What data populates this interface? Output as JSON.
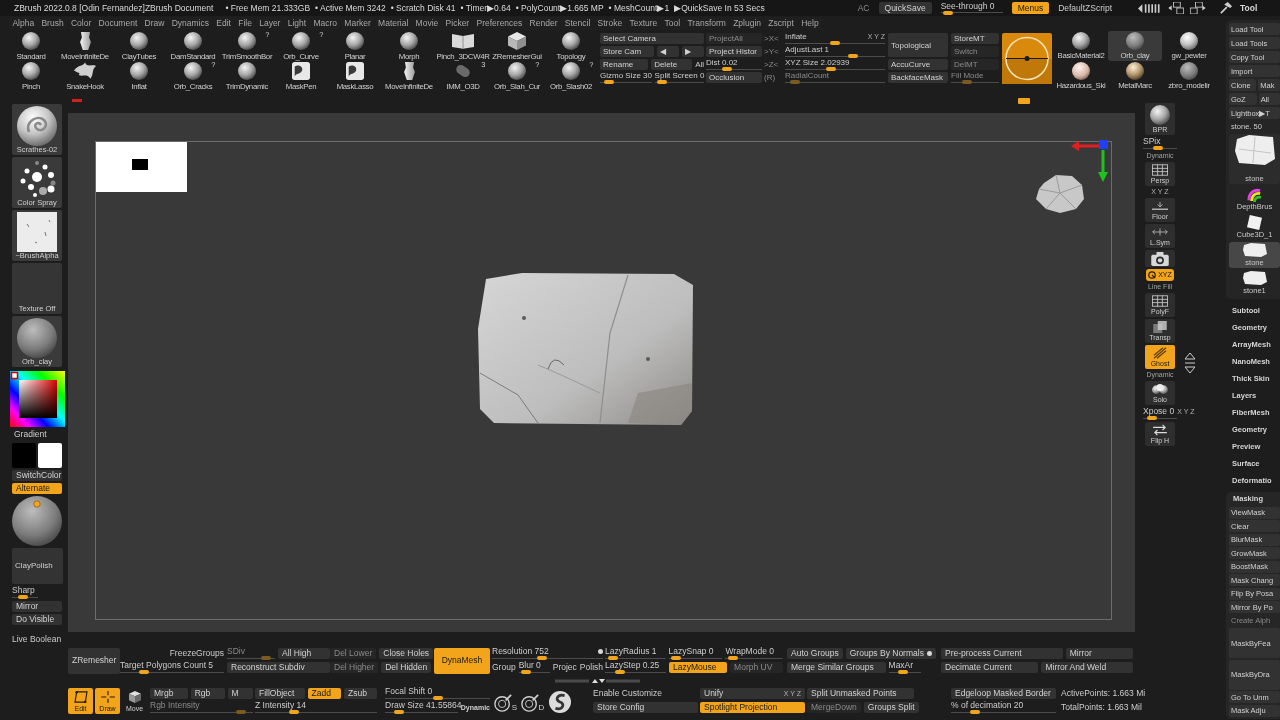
{
  "title_bar": {
    "title": "ZBrush 2022.0.8 [Odin Fernandez]ZBrush Document",
    "stats": [
      "• Free Mem 21.333GB",
      "• Active Mem 3242",
      "• Scratch Disk 41",
      "• Timer▶0.64",
      "• PolyCount▶1.665 MP",
      "• MeshCount▶1",
      "▶QuickSave In 53 Secs"
    ],
    "controls": [
      {
        "kind": "hint",
        "label": "AC"
      },
      {
        "kind": "button",
        "label": "QuickSave",
        "on": false,
        "disabled": false
      },
      {
        "kind": "slider",
        "label": "See-through 0",
        "level": 0.05,
        "disabled": false
      },
      {
        "kind": "button",
        "label": "Menus",
        "on": true,
        "disabled": false
      },
      {
        "kind": "text",
        "label": "DefaultZScript"
      }
    ],
    "palette_title": "Tool"
  },
  "menu_bar": [
    "Alpha",
    "Brush",
    "Color",
    "Document",
    "Draw",
    "Dynamics",
    "Edit",
    "File",
    "Layer",
    "Light",
    "Macro",
    "Marker",
    "Material",
    "Movie",
    "Picker",
    "Preferences",
    "Render",
    "Stencil",
    "Stroke",
    "Texture",
    "Tool",
    "Transform",
    "Zplugin",
    "Zscript",
    "Help"
  ],
  "brush_shelf": {
    "rows": [
      {
        "brushes": [
          {
            "name": "Standard",
            "kind": "sphere"
          },
          {
            "name": "MoveInfiniteDe",
            "kind": "figure"
          },
          {
            "name": "ClayTubes",
            "kind": "sphere"
          },
          {
            "name": "DamStandard",
            "kind": "sphere"
          },
          {
            "name": "TrimSmoothBor",
            "kind": "sphere",
            "badge": "?"
          },
          {
            "name": "Orb_Curve",
            "kind": "sphere",
            "badge": "?"
          },
          {
            "name": "Planar",
            "kind": "sphere"
          },
          {
            "name": "Morph",
            "kind": "sphere"
          },
          {
            "name": "Pinch_3DCW4R",
            "kind": "book"
          },
          {
            "name": "ZRemesherGui",
            "kind": "cube"
          },
          {
            "name": "Topology",
            "kind": "sphere"
          }
        ]
      },
      {
        "brushes": [
          {
            "name": "Pinch",
            "kind": "sphere"
          },
          {
            "name": "SnakeHook",
            "kind": "splash"
          },
          {
            "name": "Inflat",
            "kind": "sphere"
          },
          {
            "name": "Orb_Cracks",
            "kind": "sphere",
            "badge": "?"
          },
          {
            "name": "TrimDynamic",
            "kind": "sphere"
          },
          {
            "name": "MaskPen",
            "kind": "mask"
          },
          {
            "name": "MaskLasso",
            "kind": "mask"
          },
          {
            "name": "MoveInfiniteDe",
            "kind": "figure"
          },
          {
            "name": "IMM_O3D",
            "kind": "capsule",
            "badge": "3"
          },
          {
            "name": "Orb_Slah_Cur",
            "kind": "sphere",
            "badge": "?"
          },
          {
            "name": "Orb_Slash02",
            "kind": "sphere",
            "badge": "?"
          }
        ]
      }
    ]
  },
  "shelf_groups": [
    {
      "rows": [
        [
          {
            "kind": "button",
            "label": "Select Camera",
            "on": false,
            "disabled": false
          }
        ],
        [
          {
            "kind": "button",
            "label": "Store Cam",
            "on": false,
            "disabled": false
          },
          {
            "kind": "button",
            "label": "◀",
            "on": false,
            "disabled": false
          },
          {
            "kind": "button",
            "label": "▶",
            "on": false,
            "disabled": false
          }
        ],
        [
          {
            "kind": "button",
            "label": "Rename",
            "on": false,
            "disabled": false
          },
          {
            "kind": "button",
            "label": "Delete",
            "on": false,
            "disabled": false
          },
          {
            "kind": "text",
            "label": "All"
          }
        ],
        [
          {
            "kind": "slider",
            "label": "Gizmo Size 30",
            "level": 0.1,
            "disabled": false
          },
          {
            "kind": "slider",
            "label": "Split Screen 0",
            "level": 0.05,
            "disabled": false
          }
        ]
      ]
    },
    {
      "rows": [
        [
          {
            "kind": "button",
            "label": "ProjectAll",
            "on": false,
            "disabled": true
          }
        ],
        [
          {
            "kind": "button",
            "label": "Project Histor",
            "on": false,
            "disabled": false
          }
        ],
        [
          {
            "kind": "slider",
            "label": "Dist 0.02",
            "level": 0.35,
            "disabled": false
          }
        ],
        [
          {
            "kind": "button",
            "label": "Occlusion",
            "on": false,
            "disabled": false
          }
        ]
      ]
    },
    {
      "rows": [
        [
          {
            "kind": "hint",
            "label": ">X<"
          }
        ],
        [
          {
            "kind": "hint",
            "label": ">Y<"
          }
        ],
        [
          {
            "kind": "hint",
            "label": ">Z<"
          }
        ],
        [
          {
            "kind": "hint",
            "label": "(R)"
          }
        ]
      ]
    },
    {
      "rows": [
        [
          {
            "kind": "slider",
            "label": "Inflate",
            "axes": "X Y Z",
            "level": 0.5,
            "disabled": false
          }
        ],
        [
          {
            "kind": "slider",
            "label": "AdjustLast 1",
            "level": 0.7,
            "disabled": false
          }
        ],
        [
          {
            "kind": "slider",
            "label": "XYZ Size 2.02939",
            "level": 0.45,
            "disabled": false
          }
        ],
        [
          {
            "kind": "slider",
            "label": "RadialCount",
            "level": 0.05,
            "disabled": true
          }
        ]
      ]
    },
    {
      "rows": [
        [
          {
            "kind": "button",
            "label": "Topological",
            "on": false,
            "disabled": false
          }
        ],
        [
          {
            "kind": "button",
            "label": "AccuCurve",
            "on": false,
            "disabled": false
          }
        ],
        [
          {
            "kind": "button",
            "label": "BackfaceMask",
            "on": false,
            "disabled": false
          }
        ]
      ]
    },
    {
      "rows": [
        [
          {
            "kind": "button",
            "label": "StoreMT",
            "on": false,
            "disabled": false
          }
        ],
        [
          {
            "kind": "button",
            "label": "Switch",
            "on": false,
            "disabled": true
          }
        ],
        [
          {
            "kind": "button",
            "label": "DelMT",
            "on": false,
            "disabled": true
          }
        ],
        [
          {
            "kind": "slider",
            "label": "Fill Mode",
            "level": 0.3,
            "disabled": true
          }
        ]
      ]
    }
  ],
  "materials": [
    {
      "name": "BasicMaterial2",
      "selected": false
    },
    {
      "name": "Orb_clay",
      "selected": true
    },
    {
      "name": "gw_pewter",
      "selected": false
    },
    {
      "name": "Hazardous_Ski",
      "selected": false
    },
    {
      "name": "MetalMarc",
      "selected": false
    },
    {
      "name": "zbro_modelir",
      "selected": false
    }
  ],
  "left_shelf": {
    "thumbs": [
      {
        "label": "Scrathes-02",
        "kind": "swirl"
      },
      {
        "label": "Color Spray",
        "kind": "dots"
      },
      {
        "label": "~BrushAlpha",
        "kind": "paper"
      },
      {
        "label": "Texture Off",
        "kind": "empty"
      },
      {
        "label": "Orb_clay",
        "kind": "sphere"
      }
    ],
    "picker_label": "Gradient",
    "swatches": [
      {
        "color": "#000000"
      },
      {
        "color": "#ffffff"
      }
    ],
    "controls": [
      {
        "kind": "button",
        "label": "SwitchColor",
        "on": false,
        "disabled": false
      },
      {
        "kind": "button",
        "label": "Alternate",
        "on": true,
        "disabled": false
      },
      {
        "kind": "sphere"
      },
      {
        "kind": "panel",
        "label": "ClayPolish"
      },
      {
        "kind": "slider",
        "label": "Sharp",
        "level": 0.35,
        "disabled": false
      },
      {
        "kind": "button",
        "label": "Mirror",
        "on": false,
        "disabled": false
      },
      {
        "kind": "button",
        "label": "Do Visible",
        "on": false,
        "disabled": false
      },
      {
        "kind": "text",
        "label": "Live Boolean"
      }
    ]
  },
  "right_shelf": [
    {
      "kind": "sphere",
      "label": "BPR",
      "on": false
    },
    {
      "kind": "slider",
      "label": "SPix",
      "level": 0.4,
      "disabled": false
    },
    {
      "kind": "grid",
      "label": "Persp",
      "note": "Dynamic",
      "on": false
    },
    {
      "kind": "floor",
      "label": "Floor",
      "axes": "X Y Z",
      "on": false
    },
    {
      "kind": "sym",
      "label": "L.Sym",
      "on": false
    },
    {
      "kind": "camera",
      "on": false
    },
    {
      "kind": "rotate",
      "label": "XYZ",
      "on": true
    },
    {
      "kind": "grid",
      "label": "PolyF",
      "note": "Line Fill",
      "on": false
    },
    {
      "kind": "cube",
      "label": "Transp",
      "on": false
    },
    {
      "kind": "ghost",
      "label": "Ghost",
      "on": true
    },
    {
      "kind": "spheres",
      "label": "Solo",
      "note": "Dynamic",
      "on": false
    },
    {
      "kind": "slider",
      "label": "Xpose 0",
      "axes": "X Y Z",
      "level": 0.15,
      "disabled": false
    },
    {
      "kind": "flip",
      "label": "Flip H",
      "on": false
    }
  ],
  "tool_panel": {
    "buttons": [
      [
        "Load Tool"
      ],
      [
        "Load Tools"
      ],
      [
        "Copy Tool"
      ],
      [
        "Import"
      ],
      [
        "Clone",
        "Mak"
      ],
      [
        "GoZ",
        "All"
      ],
      [
        "Lightbox▶T"
      ]
    ],
    "tool_label": "stone. 50",
    "tools": [
      {
        "name": "stone",
        "kind": "large",
        "selected": false
      },
      {
        "name": "DepthBrus",
        "kind": "rainbow",
        "selected": false
      },
      {
        "name": "Cube3D_1",
        "kind": "cube",
        "selected": false
      },
      {
        "name": "stone",
        "kind": "stone",
        "selected": true
      },
      {
        "name": "stone1",
        "kind": "stone",
        "selected": false
      }
    ],
    "sections": [
      {
        "label": "Subtool",
        "expanded": false
      },
      {
        "label": "Geometry",
        "expanded": false
      },
      {
        "label": "ArrayMesh",
        "expanded": false
      },
      {
        "label": "NanoMesh",
        "expanded": false
      },
      {
        "label": "Thick Skin",
        "expanded": false
      },
      {
        "label": "Layers",
        "expanded": false
      },
      {
        "label": "FiberMesh",
        "expanded": false
      },
      {
        "label": "Geometry",
        "expanded": false
      },
      {
        "label": "Preview",
        "expanded": false
      },
      {
        "label": "Surface",
        "expanded": false
      },
      {
        "label": "Deformatio",
        "expanded": false
      },
      {
        "label": "Masking",
        "expanded": true,
        "items": [
          {
            "label": "ViewMask",
            "kind": "button",
            "disabled": false
          },
          {
            "label": "Clear",
            "kind": "button",
            "disabled": false
          },
          {
            "label": "BlurMask",
            "kind": "button",
            "disabled": false
          },
          {
            "label": "GrowMask",
            "kind": "button",
            "disabled": false
          },
          {
            "label": "BoostMask",
            "kind": "button",
            "disabled": false
          },
          {
            "label": "Mask Chang",
            "kind": "button",
            "disabled": false
          },
          {
            "label": "Flip By Posa",
            "kind": "button",
            "disabled": false
          },
          {
            "label": "Mirror By Po",
            "kind": "button",
            "disabled": false
          },
          {
            "label": "Create Alph",
            "kind": "button",
            "disabled": true
          },
          {
            "label": "MaskByFea",
            "kind": "group",
            "disabled": false
          },
          {
            "label": "MaskByDra",
            "kind": "group",
            "disabled": false
          },
          {
            "label": "Go To Unm",
            "kind": "button",
            "disabled": false
          },
          {
            "label": "Mask Adju",
            "kind": "button",
            "disabled": false
          }
        ]
      }
    ]
  },
  "bottom_panel": {
    "upper": [
      {
        "rows": [
          [
            {
              "kind": "button",
              "label": "ZRemesher",
              "on": false,
              "disabled": false
            }
          ]
        ]
      },
      {
        "rows": [
          [
            {
              "kind": "text",
              "label": "FreezeGroups"
            },
            {
              "kind": "slider",
              "label": "SDiv",
              "level": 0.9,
              "disabled": true
            },
            {
              "kind": "button",
              "label": "All High",
              "on": false,
              "disabled": false
            }
          ],
          [
            {
              "kind": "slider",
              "label": "Target Polygons Count 5",
              "level": 0.2,
              "disabled": false
            },
            {
              "kind": "button",
              "label": "Reconstruct Subdiv",
              "on": false,
              "disabled": false
            }
          ]
        ]
      },
      {
        "rows": [
          [
            {
              "kind": "button",
              "label": "Del Lower",
              "on": false,
              "disabled": true
            },
            {
              "kind": "button",
              "label": "Close Holes",
              "on": false,
              "disabled": false
            }
          ],
          [
            {
              "kind": "button",
              "label": "Del Higher",
              "on": false,
              "disabled": true
            },
            {
              "kind": "button",
              "label": "Del Hidden",
              "on": false,
              "disabled": false
            }
          ]
        ]
      },
      {
        "rows": [
          [
            {
              "kind": "button",
              "label": "DynaMesh",
              "on": true,
              "disabled": false
            }
          ]
        ]
      },
      {
        "rows": [
          [
            {
              "kind": "slider",
              "label": "Resolution 752",
              "dot": true,
              "level": 0.45,
              "disabled": false
            }
          ],
          [
            {
              "kind": "text",
              "label": "Group"
            },
            {
              "kind": "slider",
              "label": "Blur 0",
              "level": 0.1,
              "disabled": false
            },
            {
              "kind": "text",
              "label": "Projec"
            },
            {
              "kind": "text",
              "label": "Polish"
            }
          ]
        ]
      },
      {
        "rows": [
          [
            {
              "kind": "slider",
              "label": "LazyRadius 1",
              "level": 0.05,
              "disabled": false
            },
            {
              "kind": "slider",
              "label": "LazySnap 0",
              "level": 0.05,
              "disabled": false
            },
            {
              "kind": "slider",
              "label": "WrapMode 0",
              "level": 0.05,
              "disabled": false
            }
          ],
          [
            {
              "kind": "slider",
              "label": "LazyStep 0.25",
              "level": 0.2,
              "disabled": false
            },
            {
              "kind": "button",
              "label": "LazyMouse",
              "on": true,
              "disabled": false
            },
            {
              "kind": "button",
              "label": "Morph UV",
              "on": false,
              "disabled": true
            }
          ]
        ]
      },
      {
        "rows": [
          [
            {
              "kind": "button",
              "label": "Auto Groups",
              "on": false,
              "disabled": false
            },
            {
              "kind": "button",
              "label": "Groups By Normals",
              "dot": true,
              "on": false,
              "disabled": false
            }
          ],
          [
            {
              "kind": "button",
              "label": "Merge Similar Groups",
              "on": false,
              "disabled": false
            },
            {
              "kind": "slider",
              "label": "MaxAr",
              "level": 0.4,
              "disabled": false
            }
          ]
        ]
      },
      {
        "rows": [
          [
            {
              "kind": "button",
              "label": "Pre-process Current",
              "on": false,
              "disabled": false
            },
            {
              "kind": "button",
              "label": "Mirror",
              "on": false,
              "disabled": false
            }
          ],
          [
            {
              "kind": "button",
              "label": "Decimate Current",
              "on": false,
              "disabled": false
            },
            {
              "kind": "button",
              "label": "Mirror And Weld",
              "on": false,
              "disabled": false
            }
          ]
        ]
      }
    ],
    "lower": [
      {
        "rows": [
          [
            {
              "kind": "edit",
              "label": "Edit",
              "on": true
            },
            {
              "kind": "draw",
              "label": "Draw",
              "on": true
            },
            {
              "kind": "move",
              "label": "Move",
              "on": false
            }
          ]
        ]
      },
      {
        "rows": [
          [
            {
              "kind": "button",
              "label": "Mrgb",
              "on": false,
              "disabled": false
            },
            {
              "kind": "button",
              "label": "Rgb",
              "on": false,
              "disabled": false
            },
            {
              "kind": "button",
              "label": "M",
              "on": false,
              "disabled": false
            }
          ],
          [
            {
              "kind": "slider",
              "label": "Rgb Intensity",
              "level": 0.92,
              "disabled": true
            }
          ]
        ]
      },
      {
        "rows": [
          [
            {
              "kind": "button",
              "label": "FillObject",
              "on": false,
              "disabled": false
            },
            {
              "kind": "button",
              "label": "Zadd",
              "on": true,
              "disabled": false
            },
            {
              "kind": "button",
              "label": "Zsub",
              "on": false,
              "disabled": false
            }
          ],
          [
            {
              "kind": "slider",
              "label": "Z Intensity 14",
              "level": 0.3,
              "disabled": false
            }
          ]
        ]
      },
      {
        "rows": [
          [
            {
              "kind": "slider",
              "label": "Focal Shift 0",
              "level": 0.5,
              "disabled": false
            }
          ],
          [
            {
              "kind": "slider",
              "label": "Draw Size 41.55864",
              "level": 0.15,
              "disabled": false
            },
            {
              "kind": "tag",
              "label": "Dynamic"
            }
          ]
        ]
      },
      {
        "rows": [
          [
            {
              "kind": "brush",
              "label": "S",
              "on": false
            },
            {
              "kind": "brush",
              "label": "D",
              "on": false
            },
            {
              "kind": "logo",
              "on": false
            }
          ]
        ]
      },
      {
        "rows": [
          [
            {
              "kind": "text",
              "label": "Enable Customize"
            }
          ],
          [
            {
              "kind": "button",
              "label": "Store Config",
              "on": false,
              "disabled": false
            }
          ]
        ]
      },
      {
        "rows": [
          [
            {
              "kind": "button",
              "label": "Unify",
              "axes": "X Y Z",
              "on": false,
              "disabled": false
            }
          ],
          [
            {
              "kind": "button",
              "label": "Spotlight Projection",
              "on": true,
              "disabled": false
            }
          ]
        ]
      },
      {
        "rows": [
          [
            {
              "kind": "button",
              "label": "Split Unmasked Points",
              "on": false,
              "disabled": false
            }
          ],
          [
            {
              "kind": "button",
              "label": "MergeDown",
              "on": false,
              "disabled": true
            },
            {
              "kind": "button",
              "label": "Groups Split",
              "on": false,
              "disabled": false
            }
          ]
        ]
      },
      {
        "rows": [
          [
            {
              "kind": "button",
              "label": "Edgeloop Masked Border",
              "on": false,
              "disabled": false
            }
          ],
          [
            {
              "kind": "slider",
              "label": "% of decimation 20",
              "level": 0.2,
              "disabled": false
            }
          ]
        ]
      },
      {
        "rows": [
          [
            {
              "kind": "text",
              "label": "ActivePoints: 1.663 Mi"
            }
          ],
          [
            {
              "kind": "text",
              "label": "TotalPoints: 1.663 Mil"
            }
          ]
        ]
      }
    ]
  }
}
